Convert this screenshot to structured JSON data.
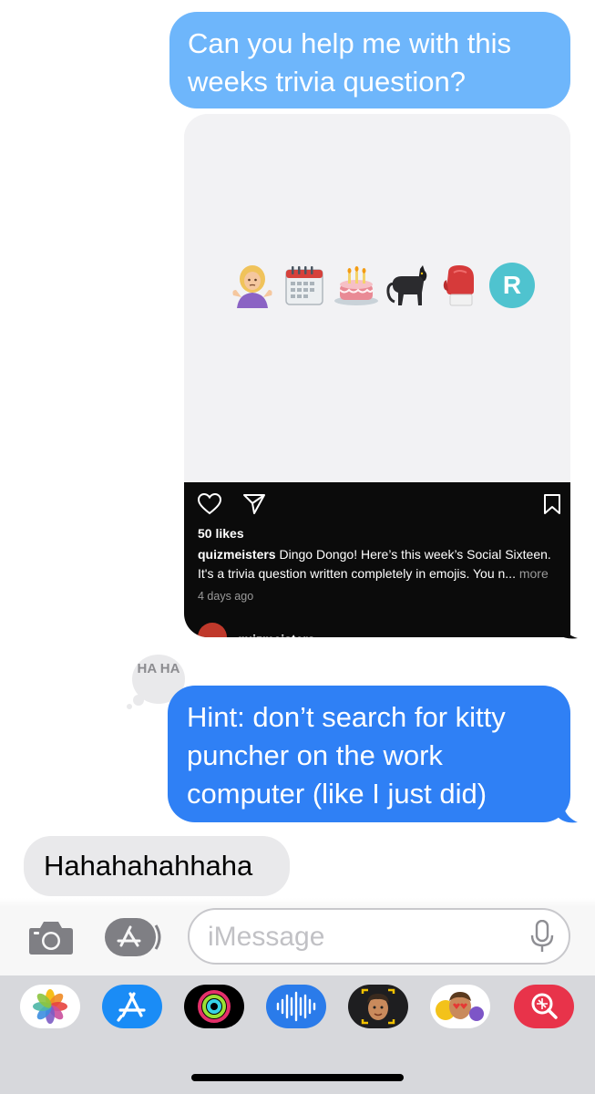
{
  "messages": {
    "outgoing_1": "Can you help me with this weeks trivia question?",
    "shared_post": {
      "likes": "50 likes",
      "username": "quizmeisters",
      "caption": "Dingo Dongo! Here’s this week’s Social Sixteen. It's a trivia question written completely in emojis. You n...",
      "more_label": "more",
      "date": "4 days ago",
      "author_label": "quizmeisters",
      "emoji_letter": "R"
    },
    "tapback": "HA HA",
    "outgoing_2": "Hint: don’t search for kitty puncher on the work computer (like I just did)",
    "incoming_1": "Hahahahahhaha"
  },
  "input": {
    "placeholder": "iMessage"
  },
  "app_drawer": {
    "apps": [
      "photos-app",
      "app-store",
      "activity",
      "audio-message",
      "memoji",
      "memoji-stickers",
      "image-search"
    ]
  },
  "colors": {
    "imessage_blue": "#2f80f5",
    "light_blue": "#6eb6fb",
    "incoming_gray": "#e9e9eb",
    "drawer_bg": "#d7d8dc"
  }
}
